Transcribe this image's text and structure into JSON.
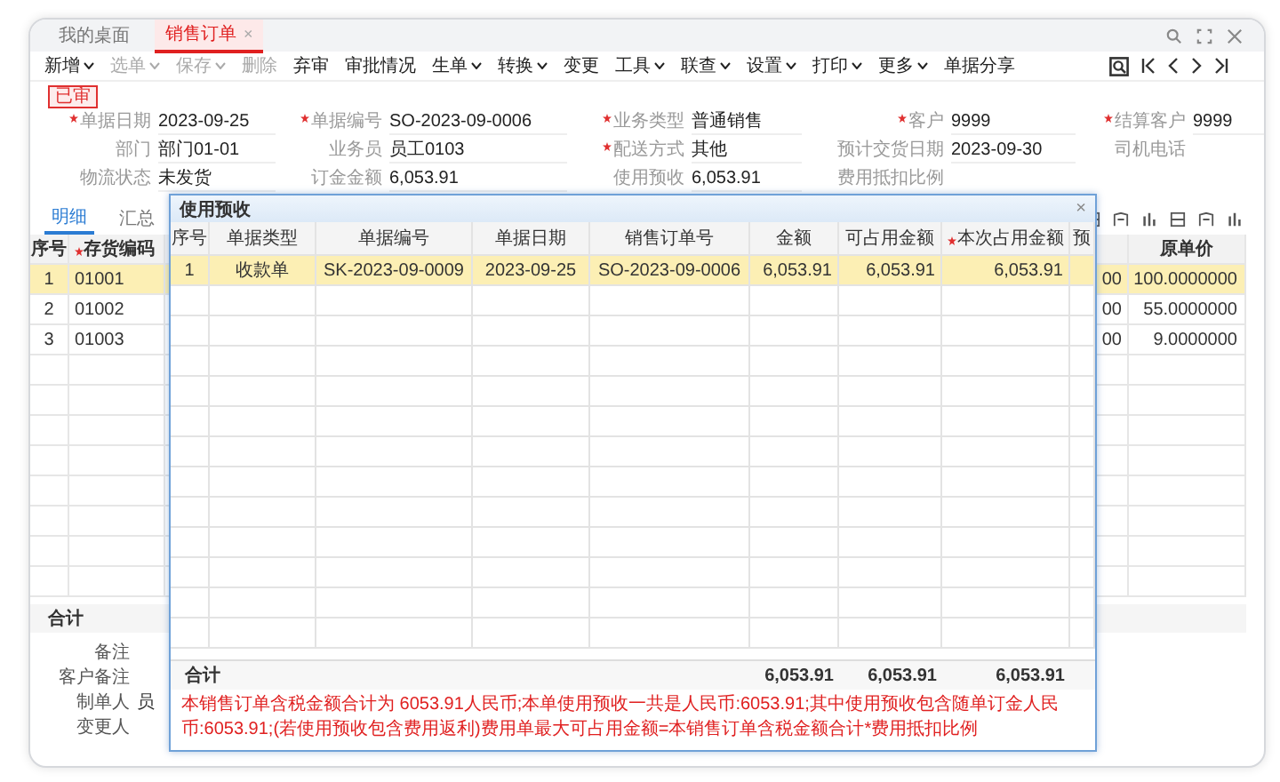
{
  "tabs": [
    {
      "label": "我的桌面",
      "selected": false
    },
    {
      "label": "销售订单",
      "selected": true,
      "close": "×"
    }
  ],
  "toolbar": [
    {
      "label": "新增",
      "dropdown": true,
      "disabled": false
    },
    {
      "label": "选单",
      "dropdown": true,
      "disabled": true
    },
    {
      "label": "保存",
      "dropdown": true,
      "disabled": true
    },
    {
      "label": "删除",
      "dropdown": false,
      "disabled": true
    },
    {
      "label": "弃审",
      "dropdown": false,
      "disabled": false
    },
    {
      "label": "审批情况",
      "dropdown": false,
      "disabled": false
    },
    {
      "label": "生单",
      "dropdown": true,
      "disabled": false
    },
    {
      "label": "转换",
      "dropdown": true,
      "disabled": false
    },
    {
      "label": "变更",
      "dropdown": false,
      "disabled": false
    },
    {
      "label": "工具",
      "dropdown": true,
      "disabled": false
    },
    {
      "label": "联查",
      "dropdown": true,
      "disabled": false
    },
    {
      "label": "设置",
      "dropdown": true,
      "disabled": false
    },
    {
      "label": "打印",
      "dropdown": true,
      "disabled": false
    },
    {
      "label": "更多",
      "dropdown": true,
      "disabled": false
    },
    {
      "label": "单据分享",
      "dropdown": false,
      "disabled": false
    }
  ],
  "status_badge": "已审",
  "form_rows": [
    [
      {
        "label": "单据日期",
        "required": true,
        "value": "2023-09-25"
      },
      {
        "label": "单据编号",
        "required": true,
        "value": "SO-2023-09-0006"
      },
      {
        "label": "业务类型",
        "required": true,
        "value": "普通销售"
      },
      {
        "label": "客户",
        "required": true,
        "value": "9999"
      },
      {
        "label": "结算客户",
        "required": true,
        "value": "9999"
      }
    ],
    [
      {
        "label": "部门",
        "value": "部门01-01"
      },
      {
        "label": "业务员",
        "value": "员工0103"
      },
      {
        "label": "配送方式",
        "required": true,
        "value": "其他"
      },
      {
        "label": "预计交货日期",
        "value": "2023-09-30"
      },
      {
        "label": "司机电话"
      }
    ],
    [
      {
        "label": "物流状态",
        "value": "未发货"
      },
      {
        "label": "订金金额",
        "value": "6,053.91"
      },
      {
        "label": "使用预收",
        "value": "6,053.91"
      },
      {
        "label": "费用抵扣比例"
      }
    ]
  ],
  "sub_tabs": [
    {
      "label": "明细",
      "selected": true
    },
    {
      "label": "汇总",
      "selected": false
    }
  ],
  "detail_table": {
    "columns": [
      {
        "label": "序号"
      },
      {
        "label": "存货编码",
        "required": true
      },
      {
        "label": "原单价"
      }
    ],
    "rows": [
      {
        "index": "1",
        "code": "01001",
        "column_3": "00",
        "price": "100.0000000",
        "selected": true
      },
      {
        "index": "2",
        "code": "01002",
        "column_3": "00",
        "price": "55.0000000",
        "selected": false
      },
      {
        "index": "3",
        "code": "01003",
        "column_3": "00",
        "price": "9.0000000",
        "selected": false
      }
    ],
    "total_label": "合计"
  },
  "remarks": [
    {
      "label": "备注"
    },
    {
      "label": "客户备注"
    },
    {
      "label": "制单人",
      "value": "员"
    },
    {
      "label": "变更人"
    }
  ],
  "dialog": {
    "title": "使用预收",
    "close": "×",
    "columns": [
      {
        "label": "序号"
      },
      {
        "label": "单据类型"
      },
      {
        "label": "单据编号"
      },
      {
        "label": "单据日期"
      },
      {
        "label": "销售订单号"
      },
      {
        "label": "金额"
      },
      {
        "label": "可占用金额"
      },
      {
        "label": "本次占用金额",
        "required": true
      },
      {
        "label": "预"
      }
    ],
    "rows": [
      {
        "cells": [
          "1",
          "收款单",
          "SK-2023-09-0009",
          "2023-09-25",
          "SO-2023-09-0006",
          "6,053.91",
          "6,053.91",
          "6,053.91"
        ],
        "selected": true
      }
    ],
    "total_label": "合计",
    "totals": [
      "6,053.91",
      "6,053.91",
      "6,053.91"
    ],
    "note": "本销售订单含税金额合计为 6053.91人民币;本单使用预收一共是人民币:6053.91;其中使用预收包含随单订金人民币:6053.91;(若使用预收包含费用返利)费用单最大可占用金额=本销售订单含税金额合计*费用抵扣比例"
  }
}
